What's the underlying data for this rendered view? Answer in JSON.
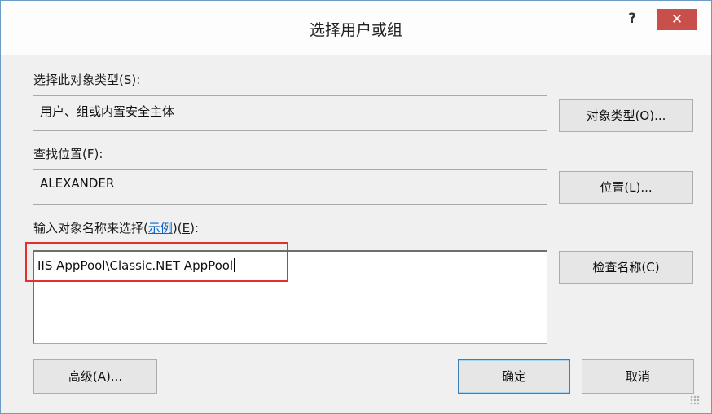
{
  "window": {
    "title": "选择用户或组",
    "help_label": "?",
    "close_label": "✕"
  },
  "object_types": {
    "label": "选择此对象类型(S):",
    "value": "用户、组或内置安全主体",
    "button": "对象类型(O)..."
  },
  "location": {
    "label": "查找位置(F):",
    "value": "ALEXANDER",
    "button": "位置(L)..."
  },
  "names": {
    "label_prefix": "输入对象名称来选择(",
    "label_link": "示例",
    "label_mid": ")(",
    "label_key": "E",
    "label_suffix": "):",
    "value": "IIS AppPool\\Classic.NET AppPool",
    "check_button": "检查名称(C)"
  },
  "footer": {
    "advanced_button": "高级(A)...",
    "ok_button": "确定",
    "cancel_button": "取消"
  },
  "colors": {
    "close_button": "#c7504b",
    "highlight_box": "#e0312d",
    "link": "#0a63c9"
  }
}
